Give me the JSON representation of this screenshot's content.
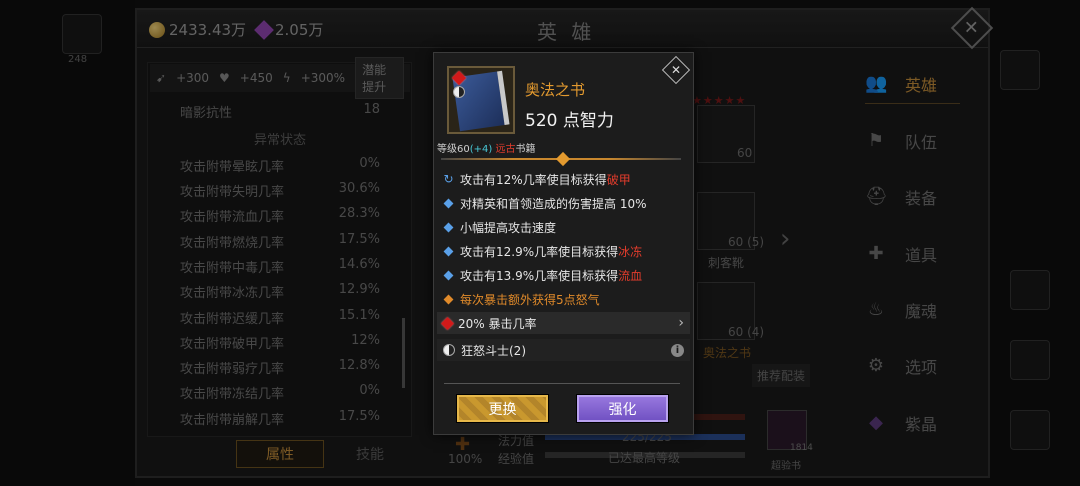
{
  "header": {
    "gold": "2433.43万",
    "gems": "2.05万",
    "title": "英 雄",
    "close_glyph": "✕"
  },
  "edges": {
    "left_count": "248"
  },
  "bonus_bar": {
    "items": [
      "+300",
      "+450",
      "+300%"
    ],
    "button": "潜能提升"
  },
  "stats": {
    "top": {
      "label": "暗影抗性",
      "value": "18"
    },
    "section_title": "异常状态",
    "rows": [
      {
        "label": "攻击附带晕眩几率",
        "value": "0%"
      },
      {
        "label": "攻击附带失明几率",
        "value": "30.6%"
      },
      {
        "label": "攻击附带流血几率",
        "value": "28.3%"
      },
      {
        "label": "攻击附带燃烧几率",
        "value": "17.5%"
      },
      {
        "label": "攻击附带中毒几率",
        "value": "14.6%"
      },
      {
        "label": "攻击附带冰冻几率",
        "value": "12.9%"
      },
      {
        "label": "攻击附带迟缓几率",
        "value": "15.1%"
      },
      {
        "label": "攻击附带破甲几率",
        "value": "12%"
      },
      {
        "label": "攻击附带弱疗几率",
        "value": "12.8%"
      },
      {
        "label": "攻击附带冻结几率",
        "value": "0%"
      },
      {
        "label": "攻击附带崩解几率",
        "value": "17.5%"
      }
    ]
  },
  "tabs": {
    "attributes": "属性",
    "skills": "技能"
  },
  "middle": {
    "item_level_1": "60",
    "item_level_2": "60 (5)",
    "item_name_2": "刺客靴",
    "item_level_3": "60 (4)",
    "item_name_3": "奥法之书",
    "recommend": "推荐配装",
    "mana_label": "法力值",
    "mana_value": "225/225",
    "exp_label": "经验值",
    "exp_value": "已达最高等级",
    "heal_pct": "100%",
    "book_count": "1814",
    "book_label": "超验书",
    "exp_progress": 1.0,
    "mana_progress": 1.0
  },
  "nav": [
    {
      "label": "英雄",
      "icon": "hero-icon",
      "glyph": "👥"
    },
    {
      "label": "队伍",
      "icon": "flag-icon",
      "glyph": "⚑"
    },
    {
      "label": "装备",
      "icon": "helmet-icon",
      "glyph": "⛑"
    },
    {
      "label": "道具",
      "icon": "bag-icon",
      "glyph": "✚"
    },
    {
      "label": "魔魂",
      "icon": "flame-icon",
      "glyph": "♨"
    },
    {
      "label": "选项",
      "icon": "gear-icon",
      "glyph": "⚙"
    },
    {
      "label": "紫晶",
      "icon": "crystal-icon",
      "glyph": "◆"
    }
  ],
  "popup": {
    "item_name": "奥法之书",
    "main_stat": "520 点智力",
    "level_prefix": "等级60",
    "level_bonus": "(+4)",
    "item_type_red": "远古",
    "item_type": "书籍",
    "effects": [
      {
        "pre": "攻击有12%几率使目标获得",
        "hl": "破甲",
        "kind": "refresh"
      },
      {
        "pre": "对精英和首领造成的伤害提高 10%",
        "hl": "",
        "kind": "blue"
      },
      {
        "pre": "小幅提高攻击速度",
        "hl": "",
        "kind": "blue"
      },
      {
        "pre": "攻击有12.9%几率使目标获得",
        "hl": "冰冻",
        "kind": "blue"
      },
      {
        "pre": "攻击有13.9%几率使目标获得",
        "hl": "流血",
        "kind": "blue"
      },
      {
        "pre": "每次暴击额外获得5点怒气",
        "hl": "",
        "kind": "orange"
      }
    ],
    "gem_row": "20% 暴击几率",
    "set_row": "狂怒斗士(2)",
    "replace_btn": "更换",
    "enhance_btn": "强化",
    "close_glyph": "✕"
  },
  "colors": {
    "accent_gold": "#e39a2f",
    "highlight_red": "#e23c2c",
    "effect_blue": "#5aa0e8",
    "button_purple": "#7b5ad0"
  }
}
